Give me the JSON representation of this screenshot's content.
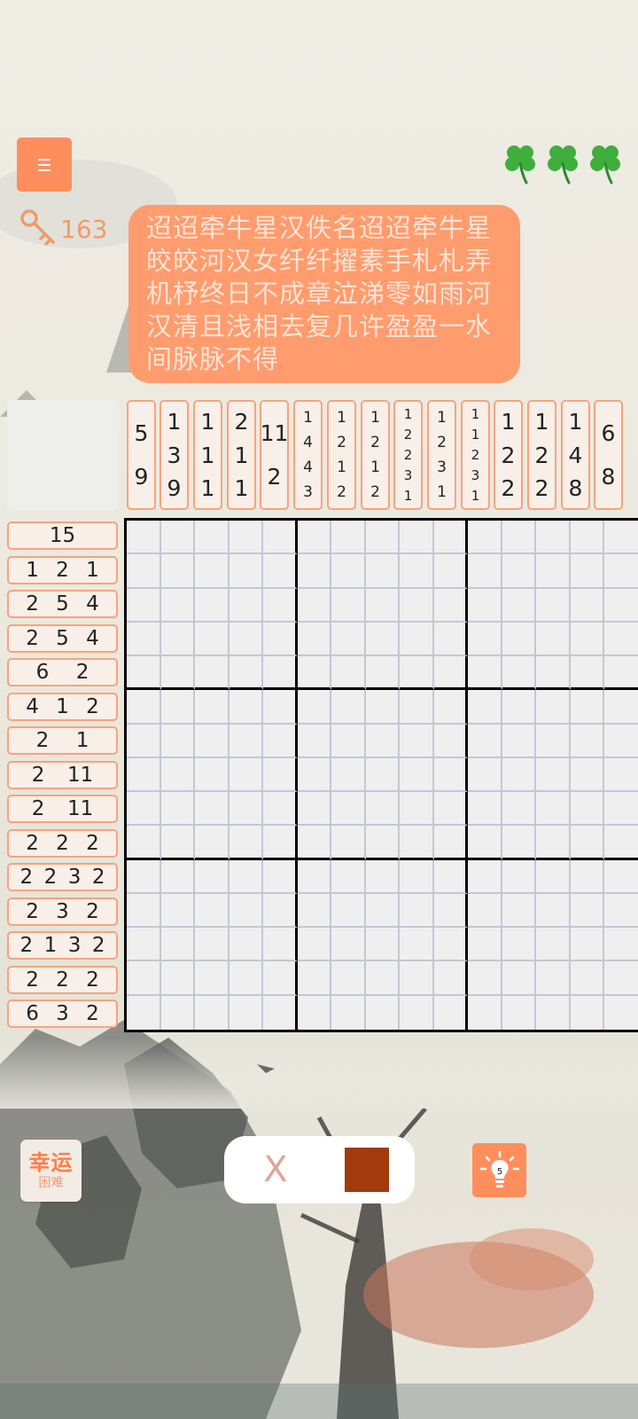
{
  "keys": {
    "count": "163"
  },
  "lives": [
    "clover-1",
    "clover-2",
    "clover-3"
  ],
  "poem": {
    "text": "迢迢牵牛星汉佚名迢迢牵牛星皎皎河汉女纤纤擢素手札札弄机杼终日不成章泣涕零如雨河汉清且浅相去复几许盈盈一水间脉脉不得"
  },
  "column_clues": [
    [
      "5",
      "9"
    ],
    [
      "1",
      "3",
      "9"
    ],
    [
      "1",
      "1",
      "1"
    ],
    [
      "2",
      "1",
      "1"
    ],
    [
      "11",
      "2"
    ],
    [
      "1",
      "4",
      "4",
      "3"
    ],
    [
      "1",
      "2",
      "1",
      "2"
    ],
    [
      "1",
      "2",
      "1",
      "2"
    ],
    [
      "1",
      "2",
      "2",
      "3",
      "1"
    ],
    [
      "1",
      "2",
      "3",
      "1"
    ],
    [
      "1",
      "1",
      "2",
      "3",
      "1"
    ],
    [
      "1",
      "2",
      "2"
    ],
    [
      "1",
      "2",
      "2"
    ],
    [
      "1",
      "4",
      "8"
    ],
    [
      "6",
      "8"
    ]
  ],
  "row_clues": [
    [
      "15"
    ],
    [
      "1",
      "2",
      "1"
    ],
    [
      "2",
      "5",
      "4"
    ],
    [
      "2",
      "5",
      "4"
    ],
    [
      "6",
      "2"
    ],
    [
      "4",
      "1",
      "2"
    ],
    [
      "2",
      "1"
    ],
    [
      "2",
      "11"
    ],
    [
      "2",
      "11"
    ],
    [
      "2",
      "2",
      "2"
    ],
    [
      "2",
      "2",
      "3",
      "2"
    ],
    [
      "2",
      "3",
      "2"
    ],
    [
      "2",
      "1",
      "3",
      "2"
    ],
    [
      "2",
      "2",
      "2"
    ],
    [
      "6",
      "3",
      "2"
    ]
  ],
  "grid": {
    "size": 15
  },
  "lucky": {
    "title": "幸运",
    "difficulty": "困难"
  },
  "modes": {
    "cross_symbol": "X"
  },
  "hint": {
    "count": "5"
  },
  "colors": {
    "accent": "#ff8e5d",
    "fill": "#a13a0c",
    "clue_border": "#f5a47e",
    "grid_line": "#c5c6d5"
  }
}
